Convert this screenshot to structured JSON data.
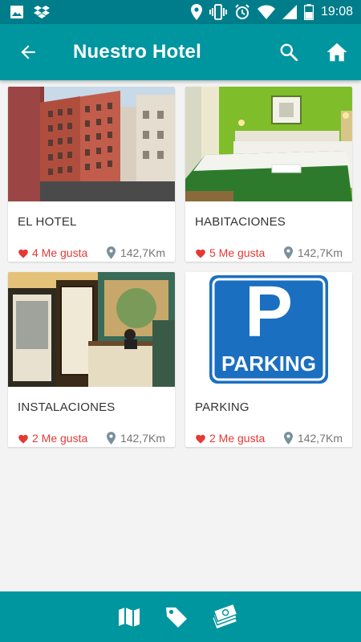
{
  "status_bar": {
    "time": "19:08",
    "icons": [
      "image-icon",
      "dropbox-icon",
      "location-icon",
      "vibrate-icon",
      "alarm-icon",
      "wifi-icon",
      "signal-icon",
      "battery-icon"
    ]
  },
  "app_bar": {
    "title": "Nuestro Hotel",
    "icons": [
      "back-arrow-icon",
      "search-icon",
      "home-icon"
    ]
  },
  "cards": [
    {
      "name": "EL HOTEL",
      "likes": "4 Me gusta",
      "distance": "142,7Km",
      "image": "hotel-building-photo"
    },
    {
      "name": "HABITACIONES",
      "likes": "5 Me gusta",
      "distance": "142,7Km",
      "image": "hotel-room-photo"
    },
    {
      "name": "INSTALACIONES",
      "likes": "2 Me gusta",
      "distance": "142,7Km",
      "image": "hotel-reception-photo"
    },
    {
      "name": "PARKING",
      "likes": "2 Me gusta",
      "distance": "142,7Km",
      "image": "parking-sign",
      "sign_letter": "P",
      "sign_text": "PARKING"
    }
  ],
  "bottom_bar": {
    "icons": [
      "map-icon",
      "tag-icon",
      "money-icon"
    ]
  },
  "colors": {
    "primary": "#00969f",
    "primary_dark": "#007d8a",
    "like": "#e53935",
    "muted": "#757575",
    "parking_blue": "#1b6fc0"
  }
}
